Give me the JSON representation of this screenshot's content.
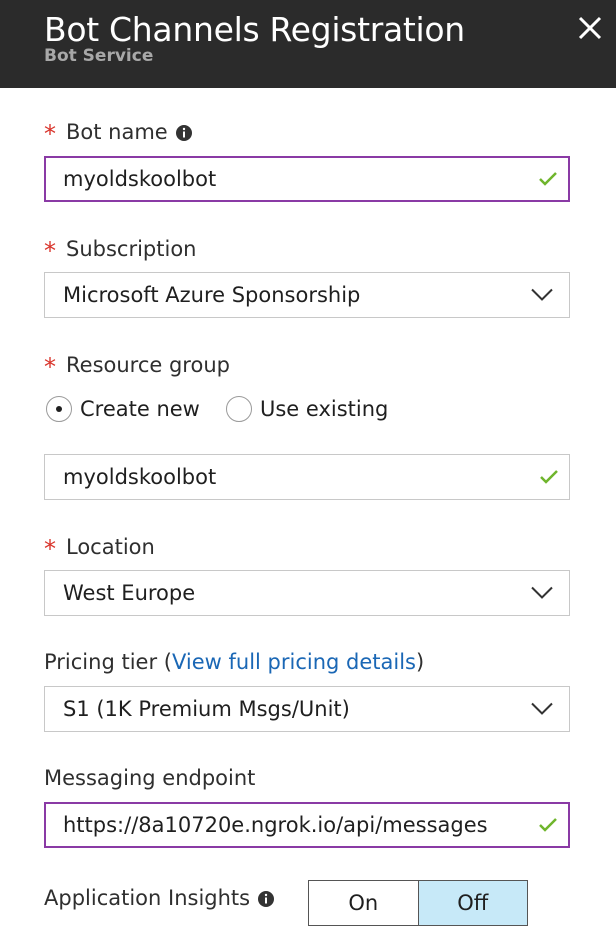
{
  "header": {
    "title": "Bot Channels Registration",
    "subtitle": "Bot Service"
  },
  "bot_name": {
    "required_mark": "*",
    "label": "Bot name",
    "value": "myoldskoolbot"
  },
  "subscription": {
    "required_mark": "*",
    "label": "Subscription",
    "value": "Microsoft Azure Sponsorship"
  },
  "resource_group": {
    "required_mark": "*",
    "label": "Resource group",
    "options": [
      "Create new",
      "Use existing"
    ],
    "selected": "Create new",
    "value": "myoldskoolbot"
  },
  "location": {
    "required_mark": "*",
    "label": "Location",
    "value": "West Europe"
  },
  "pricing": {
    "label": "Pricing tier",
    "open_paren": "(",
    "link_text": "View full pricing details",
    "close_paren": ")",
    "value": "S1 (1K Premium Msgs/Unit)"
  },
  "messaging": {
    "label": "Messaging endpoint",
    "value": "https://8a10720e.ngrok.io/api/messages"
  },
  "app_insights": {
    "label": "Application Insights",
    "on_label": "On",
    "off_label": "Off",
    "selected": "Off"
  },
  "colors": {
    "header_bg": "#2b2b2b",
    "required": "#d9342b",
    "focus_border": "#8a3aa5",
    "valid_check": "#6fb52c",
    "link": "#1a67b5",
    "toggle_selected": "#c7e9f8"
  },
  "icons": [
    "close-icon",
    "info-icon",
    "checkmark-icon",
    "chevron-down-icon"
  ]
}
